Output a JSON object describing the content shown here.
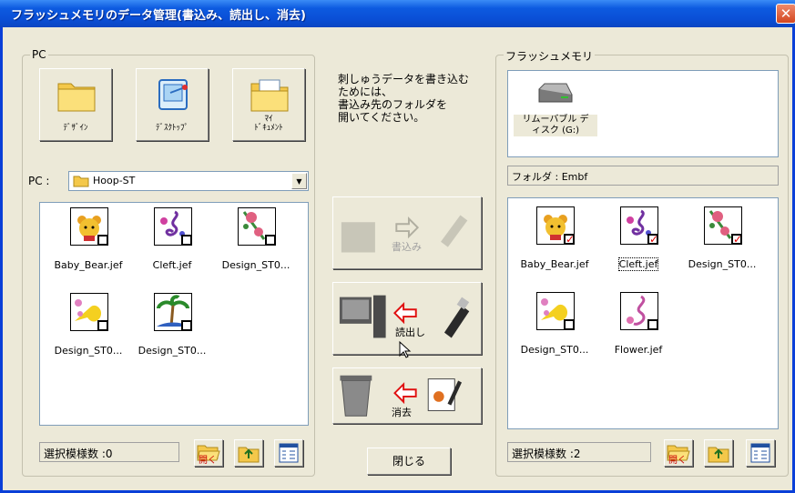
{
  "window": {
    "title": "フラッシュメモリのデータ管理(書込み、読出し、消去)",
    "close_glyph": "✕"
  },
  "pc": {
    "group_label": "PC",
    "buttons": [
      {
        "label": "ﾃﾞｻﾞｲﾝ",
        "icon": "folder-icon"
      },
      {
        "label": "ﾃﾞｽｸﾄｯﾌﾟ",
        "icon": "desktop-icon"
      },
      {
        "label": "ﾏｲ\nﾄﾞｷｭﾒﾝﾄ",
        "icon": "my-documents-icon"
      }
    ],
    "location_label": "PC :",
    "location_value": "Hoop-ST",
    "files": [
      {
        "name": "Baby_Bear.jef",
        "checked": false
      },
      {
        "name": "Cleft.jef",
        "checked": false
      },
      {
        "name": "Design_ST0...",
        "checked": false
      },
      {
        "name": "Design_ST0...",
        "checked": false
      },
      {
        "name": "Design_ST0...",
        "checked": false
      }
    ],
    "selected_count": "選択模様数 :0"
  },
  "middle": {
    "instruction": "刺しゅうデータを書き込む\nためには、\n書込み先のフォルダを\n開いてください。",
    "write_label": "書込み",
    "read_label": "読出し",
    "erase_label": "消去",
    "close_label": "閉じる"
  },
  "flash": {
    "group_label": "フラッシュメモリ",
    "device_label": "リムーバブル デ\nィスク (G:)",
    "folder_label": "フォルダ : ",
    "folder_value": "Embf",
    "files": [
      {
        "name": "Baby_Bear.jef",
        "checked": true
      },
      {
        "name": "Cleft.jef",
        "checked": true
      },
      {
        "name": "Design_ST0...",
        "checked": true
      },
      {
        "name": "Design_ST0...",
        "checked": false
      },
      {
        "name": "Flower.jef",
        "checked": false
      }
    ],
    "selected_count": "選択模様数 :2"
  },
  "toolbar": {
    "open_label": "開く"
  },
  "colors": {
    "title_blue": "#0a4fd6",
    "face": "#ece9d8",
    "check_red": "#e00000"
  }
}
